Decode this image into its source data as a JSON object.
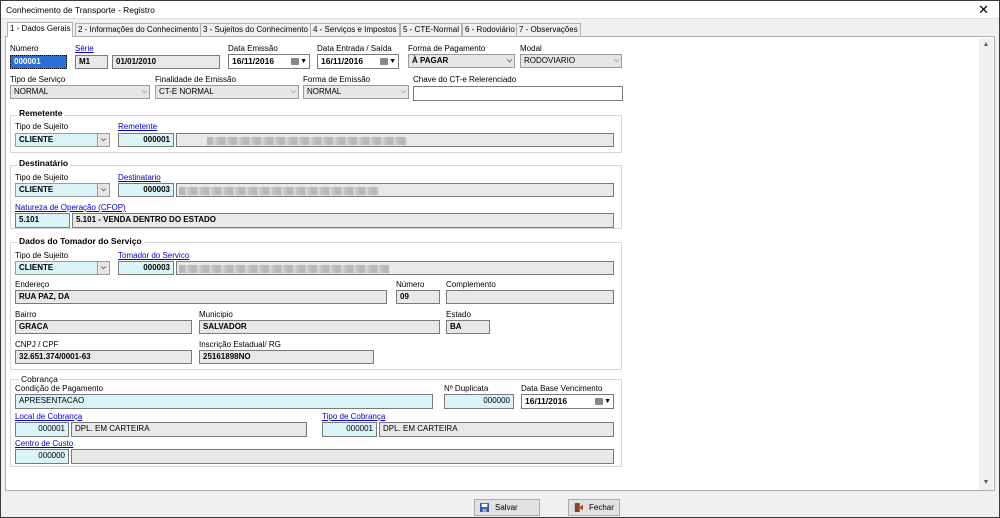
{
  "window": {
    "title": "Conhecimento de Transporte - Registro",
    "close": "✕"
  },
  "tabs": [
    "1 - Dados Gerais",
    "2 - Informações do Conhecimento",
    "3 - Sujeitos do Conhecimento",
    "4 - Serviços e Impostos",
    "5 - CTE-Normal",
    "6 - Rodoviário",
    "7 - Observações"
  ],
  "top": {
    "numero_label": "Número",
    "numero": "000001",
    "serie_label": "Série",
    "serie": "M1",
    "serie_date": "01/01/2010",
    "data_emissao_label": "Data Emissão",
    "data_emissao": "16/11/2016",
    "data_entrada_label": "Data Entrada / Saída",
    "data_entrada": "16/11/2016",
    "forma_pagamento_label": "Forma de Pagamento",
    "forma_pagamento": "À PAGAR",
    "modal_label": "Modal",
    "modal": "RODOVIARIO",
    "tipo_servico_label": "Tipo de Serviço",
    "tipo_servico": "NORMAL",
    "finalidade_label": "Finalidade de Emissão",
    "finalidade": "CT-E NORMAL",
    "forma_emissao_label": "Forma de Emissão",
    "forma_emissao": "NORMAL",
    "chave_label": "Chave do CT-e Relerenciado",
    "chave": ""
  },
  "remetente": {
    "title": "Remetente",
    "tipo_label": "Tipo de Sujeito",
    "tipo": "CLIENTE",
    "link": "Remetente",
    "codigo": "000001"
  },
  "destinatario": {
    "title": "Destinatário",
    "tipo_label": "Tipo de Sujeito",
    "tipo": "CLIENTE",
    "link": "Destinatario",
    "codigo": "000003",
    "cfop_link": "Natureza de Operação (CFOP)",
    "cfop": "5.101",
    "cfop_desc": "5.101 - VENDA DENTRO DO ESTADO"
  },
  "tomador": {
    "title": "Dados do Tomador do Serviço",
    "tipo_label": "Tipo de Sujeito",
    "tipo": "CLIENTE",
    "link": "Tomador  do Servico",
    "codigo": "000003",
    "endereco_label": "Endereço",
    "endereco": "RUA PAZ, DA",
    "numero_label": "Número",
    "numero": "09",
    "complemento_label": "Complemento",
    "complemento": "",
    "bairro_label": "Bairro",
    "bairro": "GRACA",
    "municipio_label": "Municipio",
    "municipio": "SALVADOR",
    "estado_label": "Estado",
    "estado": "BA",
    "cnpj_label": "CNPJ / CPF",
    "cnpj": "32.651.374/0001-63",
    "ie_label": "Inscrição Estadual/ RG",
    "ie": "25161898NO"
  },
  "cobranca": {
    "title": "Cobrança",
    "condicao_label": "Condição de Pagamento",
    "condicao": "APRESENTACAO",
    "duplicata_label": "Nº Duplicata",
    "duplicata": "000000",
    "base_label": "Data Base Vencimento",
    "base": "16/11/2016",
    "local_link": "Local de Cobrança",
    "local_cod": "000001",
    "local": "DPL. EM CARTEIRA",
    "tipo_link": "Tipo de Cobrança",
    "tipo_cod": "000001",
    "tipo": "DPL. EM CARTEIRA",
    "centro_link": "Centro de Custo",
    "centro_cod": "000000",
    "centro": ""
  },
  "buttons": {
    "salvar": "Salvar",
    "fechar": "Fechar"
  },
  "colors": {
    "accent_field": "#d9f3f7",
    "link": "#0000cc"
  }
}
